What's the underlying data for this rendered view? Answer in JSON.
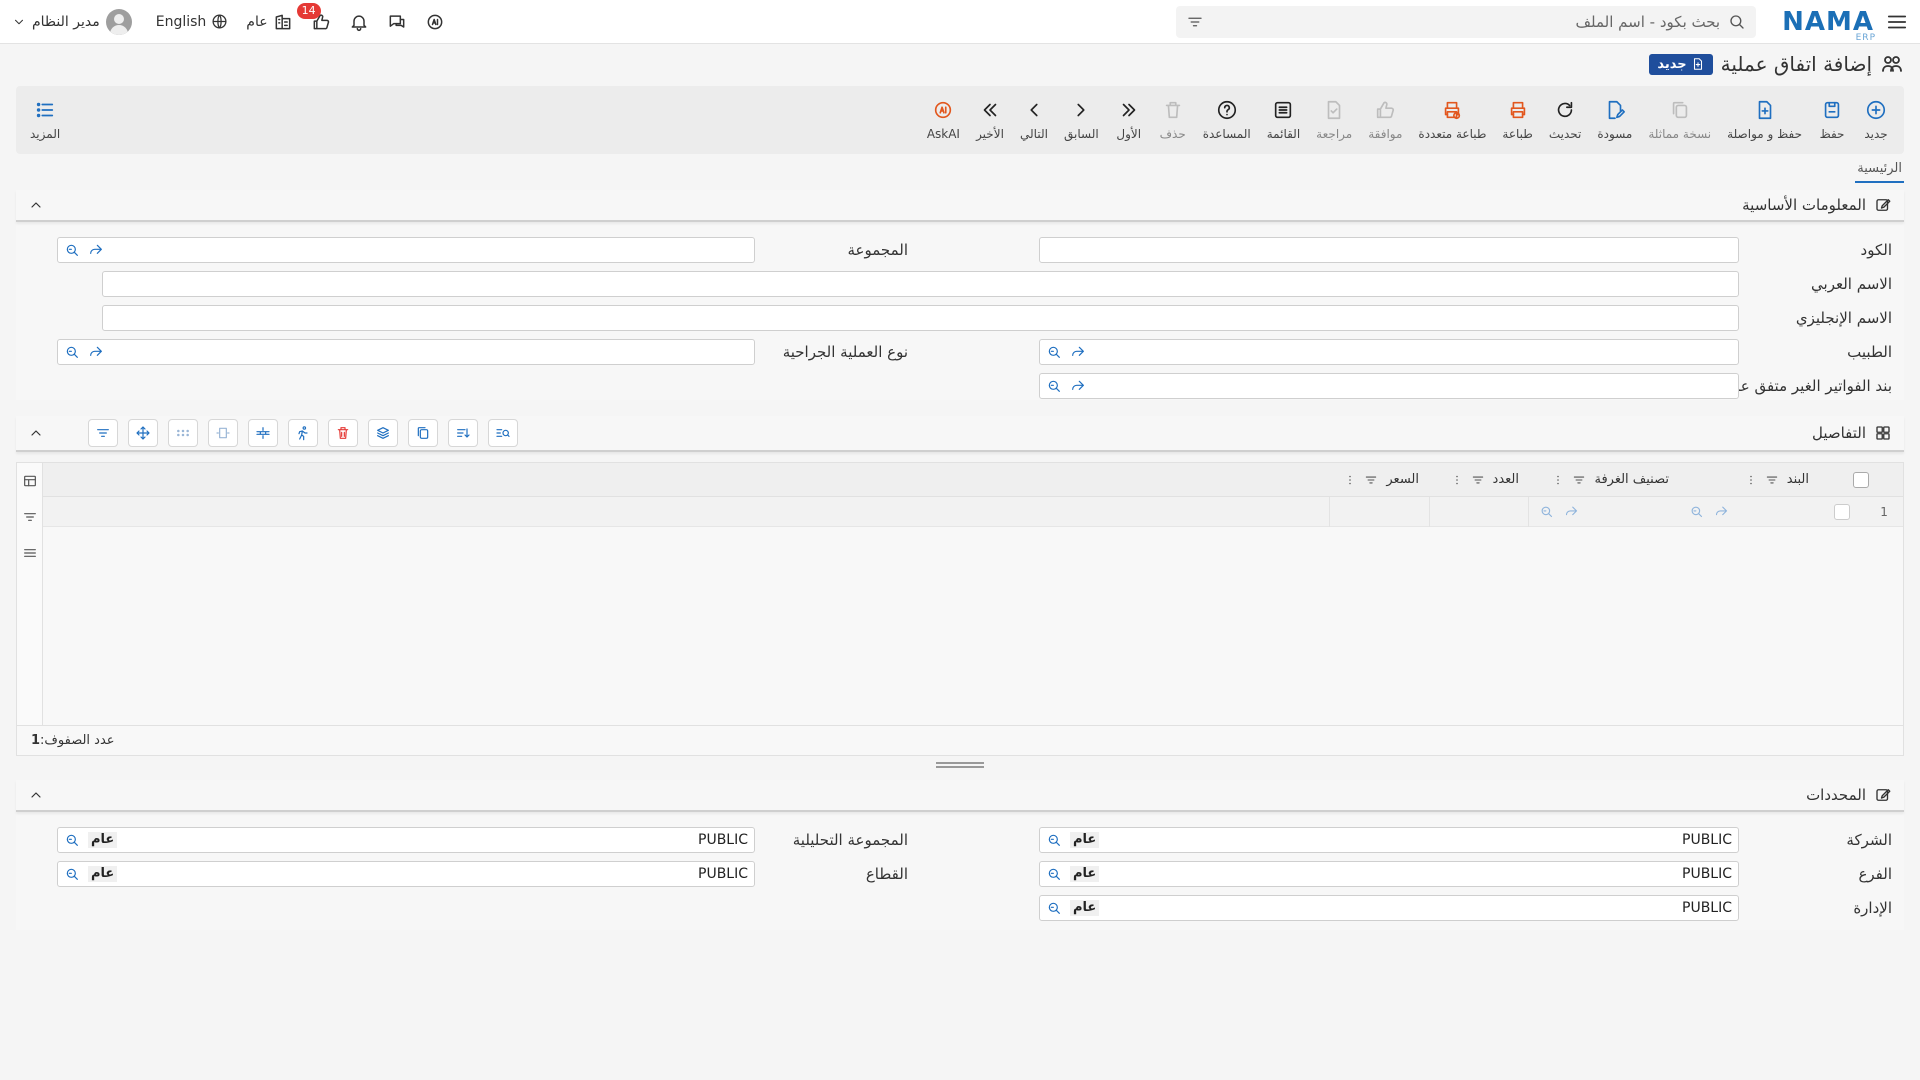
{
  "header": {
    "logo": "NAMA",
    "logo_sub": "ERP",
    "search_placeholder": "بحث بكود - اسم الملف",
    "language": "English",
    "context": "عام",
    "notification_count": "14",
    "user_name": "مدير النظام"
  },
  "page": {
    "title": "إضافة اتفاق عملية",
    "badge": "جديد"
  },
  "toolbar": {
    "new": "جديد",
    "save": "حفظ",
    "save_continue": "حفظ و مواصلة",
    "duplicate": "نسخة مماثلة",
    "draft": "مسودة",
    "refresh": "تحديث",
    "print": "طباعة",
    "multi_print": "طباعة متعددة",
    "approve": "موافقة",
    "review": "مراجعة",
    "list": "القائمة",
    "help": "المساعدة",
    "delete": "حذف",
    "first": "الأول",
    "previous": "السابق",
    "next": "التالي",
    "last": "الأخير",
    "askai": "AskAI",
    "more": "المزيد"
  },
  "tabs": {
    "main": "الرئيسية"
  },
  "basic_info": {
    "title": "المعلومات الأساسية",
    "code_label": "الكود",
    "group_label": "المجموعة",
    "arabic_name_label": "الاسم العربي",
    "english_name_label": "الاسم الإنجليزي",
    "doctor_label": "الطبيب",
    "surgery_type_label": "نوع العملية الجراحية",
    "non_agreed_item_label": "بند الفواتير الغير متفق عليها"
  },
  "details": {
    "title": "التفاصيل",
    "columns": [
      "البند",
      "تصنيف الغرفة",
      "العدد",
      "السعر"
    ],
    "rows": [
      {
        "num": "1"
      }
    ],
    "row_count_label": "عدد الصفوف:",
    "row_count": "1"
  },
  "dimensions": {
    "title": "المحددات",
    "company_label": "الشركة",
    "company_value": "PUBLIC",
    "company_tag": "عام",
    "branch_label": "الفرع",
    "branch_value": "PUBLIC",
    "branch_tag": "عام",
    "department_label": "الإدارة",
    "department_value": "PUBLIC",
    "department_tag": "عام",
    "analytic_group_label": "المجموعة التحليلية",
    "analytic_group_value": "PUBLIC",
    "analytic_group_tag": "عام",
    "sector_label": "القطاع",
    "sector_value": "PUBLIC",
    "sector_tag": "عام"
  },
  "colors": {
    "brand": "#1b6fb6",
    "accent_orange": "#e2571e",
    "badge_red": "#e53935",
    "new_badge": "#1f4e9c"
  }
}
